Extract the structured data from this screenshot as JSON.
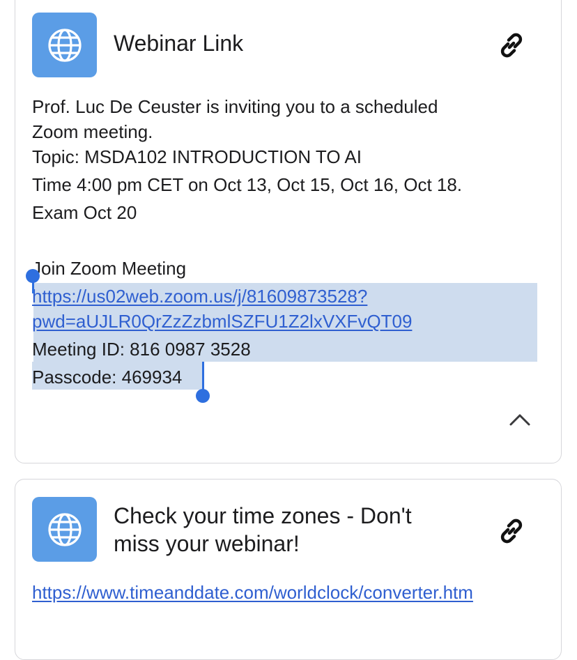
{
  "webinar_card": {
    "title": "Webinar Link",
    "icon": "globe-icon",
    "action_icon": "link-icon",
    "message_lines": [
      "Prof. Luc De Ceuster is inviting you to a scheduled",
      "Zoom meeting.",
      "Topic: MSDA102 INTRODUCTION TO AI",
      "Time 4:00 pm CET on  Oct 13, Oct 15, Oct 16, Oct 18.",
      "Exam Oct 20"
    ],
    "join_label": "Join Zoom Meeting",
    "join_link_line1": "https://us02web.zoom.us/j/81609873528?",
    "join_link_line2": "pwd=aUJLR0QrZzZzbmlSZFU1Z2lxVXFvQT09",
    "meeting_id": "Meeting ID: 816 0987 3528",
    "passcode": "Passcode: 469934",
    "collapse_icon": "chevron-up-icon"
  },
  "timezone_card": {
    "title_line1": "Check your time zones - Don't",
    "title_line2": "miss your webinar!",
    "icon": "globe-icon",
    "action_icon": "link-icon",
    "link": "https://www.timeanddate.com/worldclock/converter.htm"
  },
  "colors": {
    "icon_bg": "#5b9de6",
    "link": "#2f5fd0",
    "selection": "#c9d8ec",
    "selection_handle": "#2e6fdf"
  }
}
